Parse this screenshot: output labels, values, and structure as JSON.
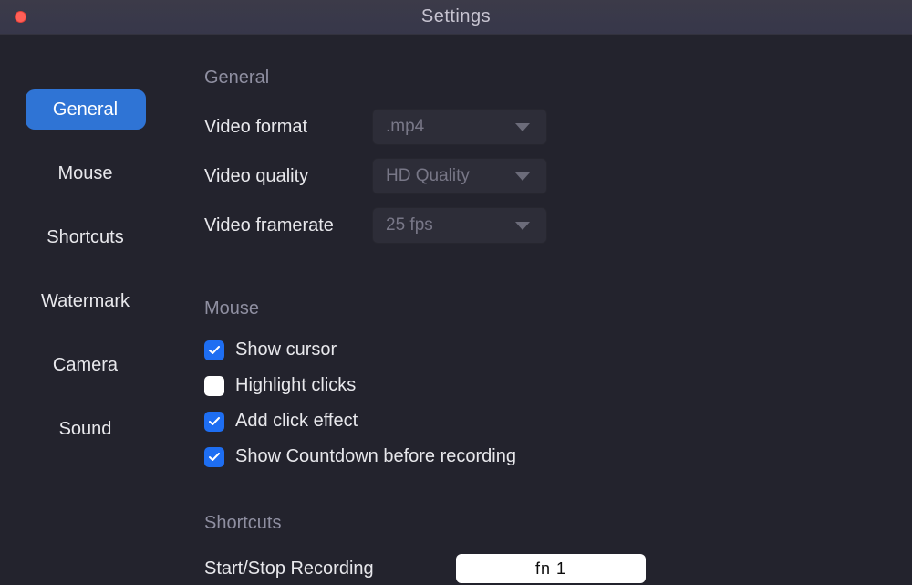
{
  "window": {
    "title": "Settings"
  },
  "sidebar": {
    "items": [
      {
        "label": "General",
        "active": true
      },
      {
        "label": "Mouse",
        "active": false
      },
      {
        "label": "Shortcuts",
        "active": false
      },
      {
        "label": "Watermark",
        "active": false
      },
      {
        "label": "Camera",
        "active": false
      },
      {
        "label": "Sound",
        "active": false
      }
    ]
  },
  "sections": {
    "general": {
      "title": "General",
      "video_format": {
        "label": "Video format",
        "value": ".mp4"
      },
      "video_quality": {
        "label": "Video quality",
        "value": "HD Quality"
      },
      "video_framerate": {
        "label": "Video framerate",
        "value": "25 fps"
      }
    },
    "mouse": {
      "title": "Mouse",
      "show_cursor": {
        "label": "Show cursor",
        "checked": true
      },
      "highlight_clicks": {
        "label": "Highlight clicks",
        "checked": false
      },
      "add_click_effect": {
        "label": "Add click effect",
        "checked": true
      },
      "show_countdown": {
        "label": "Show Countdown before recording",
        "checked": true
      }
    },
    "shortcuts": {
      "title": "Shortcuts",
      "start_stop": {
        "label": "Start/Stop Recording",
        "value": "fn 1"
      }
    }
  }
}
